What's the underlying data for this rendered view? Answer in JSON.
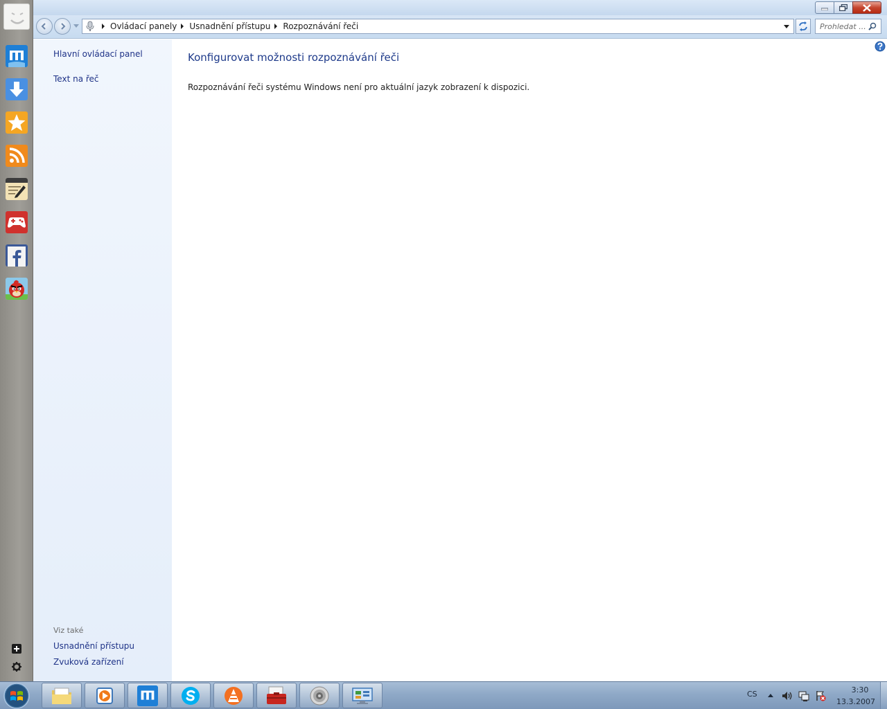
{
  "window": {
    "breadcrumb": [
      "Ovládací panely",
      "Usnadnění přístupu",
      "Rozpoznávání řeči"
    ],
    "search_placeholder": "Prohledat ...",
    "colors": {
      "link": "#1e3287",
      "title": "#1e3a8a",
      "close_button": "#c5452f"
    }
  },
  "left_pane": {
    "links": [
      "Hlavní ovládací panel",
      "Text na řeč"
    ],
    "see_also_heading": "Viz také",
    "see_also_links": [
      "Usnadnění přístupu",
      "Zvuková zařízení"
    ]
  },
  "main": {
    "title": "Konfigurovat možnosti rozpoznávání řeči",
    "message": "Rozpoznávání řeči systému Windows není pro aktuální jazyk zobrazení k dispozici."
  },
  "dock": {
    "apps": [
      "maxthon-icon",
      "download-icon",
      "star-icon",
      "rss-icon",
      "notes-icon",
      "gamepad-icon",
      "facebook-icon",
      "angry-birds-icon"
    ]
  },
  "taskbar": {
    "apps": [
      "file-explorer-icon",
      "media-player-icon",
      "maxthon-icon",
      "skype-icon",
      "vlc-icon",
      "toolbox-icon",
      "speaker-icon",
      "control-panel-icon"
    ],
    "language": "CS",
    "time": "3:30",
    "date": "13.3.2007"
  }
}
